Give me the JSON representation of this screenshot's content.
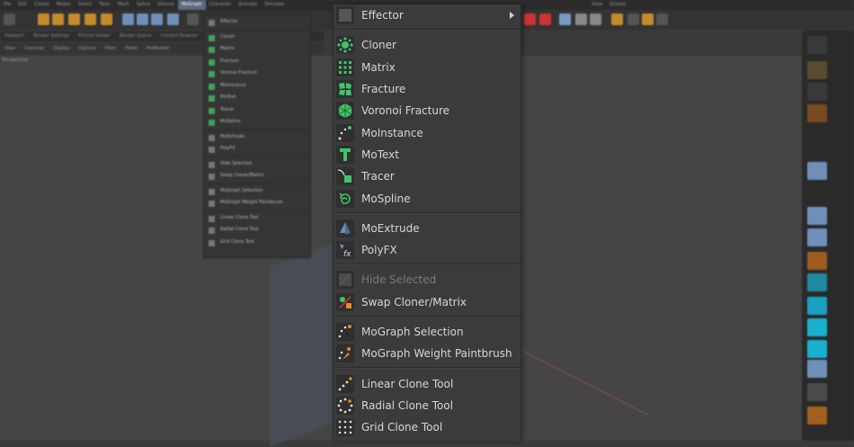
{
  "background": {
    "menubar": [
      "File",
      "Edit",
      "Create",
      "Modes",
      "Select",
      "Tools",
      "Mesh",
      "Spline",
      "Volume",
      "MoGraph",
      "Character",
      "Animate",
      "Simulate",
      "View",
      "Octane"
    ],
    "active_menu": "MoGraph",
    "tabs": [
      "Viewport",
      "Render Settings",
      "Picture Viewer",
      "Render Queue",
      "Content Browser"
    ],
    "viewbar": [
      "View",
      "Cameras",
      "Display",
      "Options",
      "Filter",
      "Panel",
      "ProRender"
    ],
    "viewport_label": "Perspective"
  },
  "small_menu": {
    "items": [
      {
        "label": "Effector",
        "kind": "head"
      },
      {
        "label": "Cloner",
        "kind": "g1"
      },
      {
        "label": "Matrix",
        "kind": "g1"
      },
      {
        "label": "Fracture",
        "kind": "g1"
      },
      {
        "label": "Voronoi Fracture",
        "kind": "g1"
      },
      {
        "label": "MoInstance",
        "kind": "g1"
      },
      {
        "label": "MoText",
        "kind": "g1"
      },
      {
        "label": "Tracer",
        "kind": "g1"
      },
      {
        "label": "MoSpline",
        "kind": "g1"
      },
      {
        "label": "MoExtrude",
        "kind": "g2"
      },
      {
        "label": "PolyFX",
        "kind": "g2"
      },
      {
        "label": "Hide Selected",
        "kind": "g3"
      },
      {
        "label": "Swap Cloner/Matrix",
        "kind": "g3"
      },
      {
        "label": "MoGraph Selection",
        "kind": "g4"
      },
      {
        "label": "MoGraph Weight Paintbrush",
        "kind": "g4"
      },
      {
        "label": "Linear Clone Tool",
        "kind": "g5"
      },
      {
        "label": "Radial Clone Tool",
        "kind": "g5"
      },
      {
        "label": "Grid Clone Tool",
        "kind": "g5"
      }
    ]
  },
  "menu": {
    "effector": {
      "label": "Effector",
      "icon": "effector-icon"
    },
    "group1": [
      {
        "label": "Cloner",
        "icon": "cloner-icon"
      },
      {
        "label": "Matrix",
        "icon": "matrix-icon"
      },
      {
        "label": "Fracture",
        "icon": "fracture-icon"
      },
      {
        "label": "Voronoi Fracture",
        "icon": "voronoi-fracture-icon"
      },
      {
        "label": "MoInstance",
        "icon": "moinstance-icon"
      },
      {
        "label": "MoText",
        "icon": "motext-icon"
      },
      {
        "label": "Tracer",
        "icon": "tracer-icon"
      },
      {
        "label": "MoSpline",
        "icon": "mospline-icon"
      }
    ],
    "group2": [
      {
        "label": "MoExtrude",
        "icon": "moextrude-icon"
      },
      {
        "label": "PolyFX",
        "icon": "polyfx-icon"
      }
    ],
    "group3": [
      {
        "label": "Hide Selected",
        "icon": "hide-selected-icon",
        "disabled": true
      },
      {
        "label": "Swap Cloner/Matrix",
        "icon": "swap-cloner-matrix-icon"
      }
    ],
    "group4": [
      {
        "label": "MoGraph Selection",
        "icon": "mograph-selection-icon"
      },
      {
        "label": "MoGraph Weight Paintbrush",
        "icon": "mograph-weight-paintbrush-icon"
      }
    ],
    "group5": [
      {
        "label": "Linear Clone Tool",
        "icon": "linear-clone-tool-icon"
      },
      {
        "label": "Radial Clone Tool",
        "icon": "radial-clone-tool-icon"
      },
      {
        "label": "Grid Clone Tool",
        "icon": "grid-clone-tool-icon"
      }
    ]
  },
  "colors": {
    "accent_green": "#3fc46a",
    "accent_blue": "#6f8fb8",
    "menu_bg": "#3b3b3b"
  }
}
